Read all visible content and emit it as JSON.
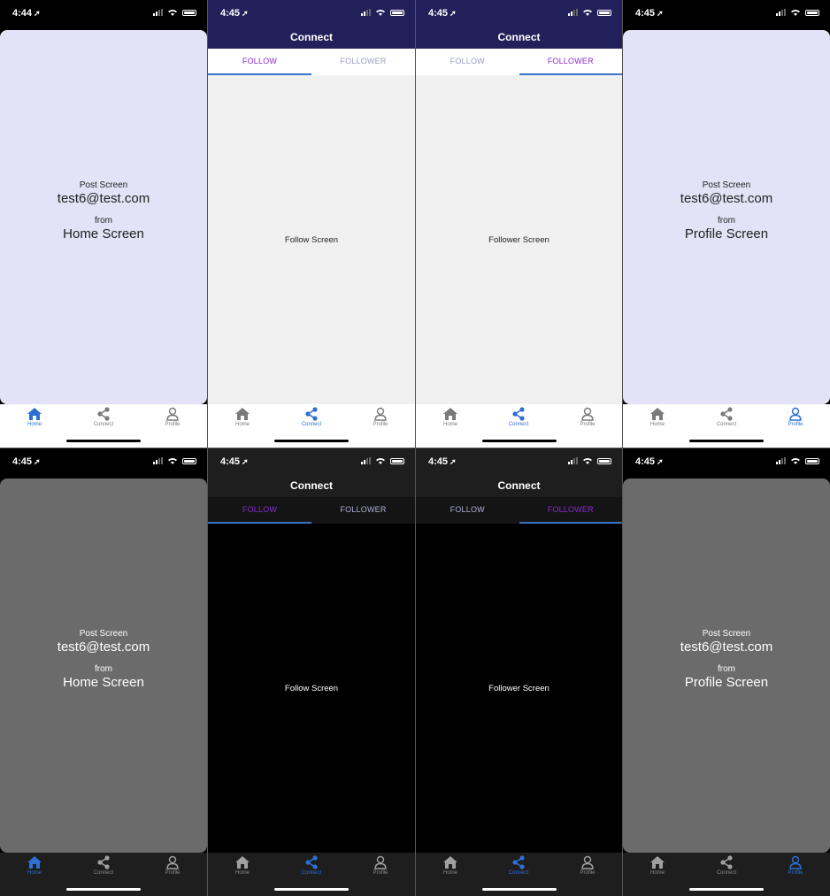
{
  "colors": {
    "light_card": "#e3e2f6",
    "dark_card": "#6b6b6b",
    "navy_header": "#22205a",
    "dark_header": "#1e1e1e",
    "light_content": "#f0f0f0",
    "dark_content": "#000000",
    "active_tab_purple": "#8a2bd2",
    "inactive_tab_light": "#9b9bc4",
    "inactive_tab_dark": "#b0b0d8",
    "tab_underline": "#3a74c9",
    "icon_active": "#2f6fd4",
    "icon_inactive": "#7a7a7a"
  },
  "status_times": [
    "4:44",
    "4:45",
    "4:45",
    "4:45",
    "4:45",
    "4:45",
    "4:45",
    "4:45"
  ],
  "tabbar_labels": {
    "home": "Home",
    "connect": "Connect",
    "profile": "Profile"
  },
  "post_home": {
    "title": "Post Screen",
    "email": "test6@test.com",
    "from": "from",
    "source": "Home Screen"
  },
  "post_profile": {
    "title": "Post Screen",
    "email": "test6@test.com",
    "from": "from",
    "source": "Profile Screen"
  },
  "connect": {
    "title": "Connect",
    "tabs": [
      "FOLLOW",
      "FOLLOWER"
    ],
    "follow_label": "Follow Screen",
    "follower_label": "Follower Screen"
  },
  "icons": [
    "home-icon",
    "share-icon",
    "person-icon",
    "location-arrow-icon",
    "signal-icon",
    "wifi-icon",
    "battery-icon"
  ]
}
